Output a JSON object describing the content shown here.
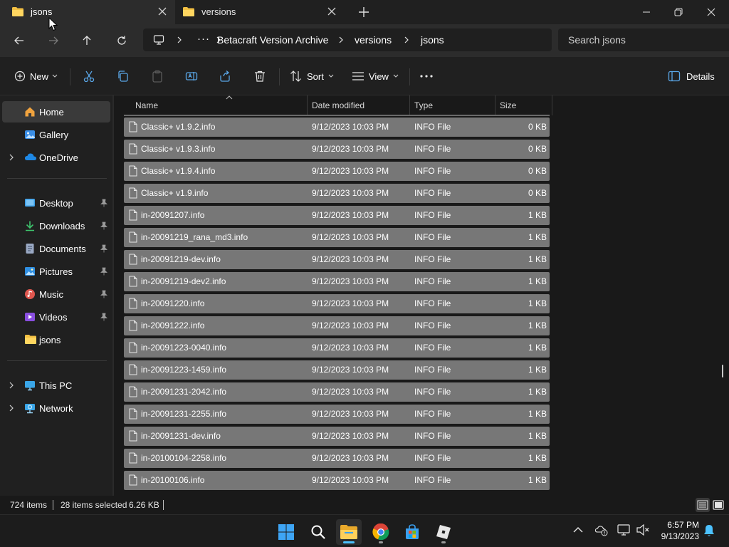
{
  "tabs": [
    {
      "title": "jsons",
      "active": true
    },
    {
      "title": "versions",
      "active": false
    }
  ],
  "address": {
    "segments": [
      "Betacraft Version Archive",
      "versions",
      "jsons"
    ]
  },
  "search": {
    "placeholder": "Search jsons"
  },
  "commands": {
    "new_label": "New",
    "sort_label": "Sort",
    "view_label": "View",
    "details_label": "Details"
  },
  "sidebar": {
    "items": [
      {
        "label": "Home",
        "icon": "home-icon"
      },
      {
        "label": "Gallery",
        "icon": "gallery-icon"
      },
      {
        "label": "OneDrive",
        "icon": "onedrive-icon"
      },
      {
        "label": "Desktop",
        "icon": "desktop-icon"
      },
      {
        "label": "Downloads",
        "icon": "downloads-icon"
      },
      {
        "label": "Documents",
        "icon": "documents-icon"
      },
      {
        "label": "Pictures",
        "icon": "pictures-icon"
      },
      {
        "label": "Music",
        "icon": "music-icon"
      },
      {
        "label": "Videos",
        "icon": "videos-icon"
      },
      {
        "label": "jsons",
        "icon": "folder-icon"
      },
      {
        "label": "This PC",
        "icon": "this-pc-icon"
      },
      {
        "label": "Network",
        "icon": "network-icon"
      }
    ]
  },
  "columns": {
    "name": "Name",
    "date": "Date modified",
    "type": "Type",
    "size": "Size"
  },
  "files": [
    {
      "name": "Classic+ v1.9.2.info",
      "date": "9/12/2023 10:03 PM",
      "type": "INFO File",
      "size": "0 KB"
    },
    {
      "name": "Classic+ v1.9.3.info",
      "date": "9/12/2023 10:03 PM",
      "type": "INFO File",
      "size": "0 KB"
    },
    {
      "name": "Classic+ v1.9.4.info",
      "date": "9/12/2023 10:03 PM",
      "type": "INFO File",
      "size": "0 KB"
    },
    {
      "name": "Classic+ v1.9.info",
      "date": "9/12/2023 10:03 PM",
      "type": "INFO File",
      "size": "0 KB"
    },
    {
      "name": "in-20091207.info",
      "date": "9/12/2023 10:03 PM",
      "type": "INFO File",
      "size": "1 KB"
    },
    {
      "name": "in-20091219_rana_md3.info",
      "date": "9/12/2023 10:03 PM",
      "type": "INFO File",
      "size": "1 KB"
    },
    {
      "name": "in-20091219-dev.info",
      "date": "9/12/2023 10:03 PM",
      "type": "INFO File",
      "size": "1 KB"
    },
    {
      "name": "in-20091219-dev2.info",
      "date": "9/12/2023 10:03 PM",
      "type": "INFO File",
      "size": "1 KB"
    },
    {
      "name": "in-20091220.info",
      "date": "9/12/2023 10:03 PM",
      "type": "INFO File",
      "size": "1 KB"
    },
    {
      "name": "in-20091222.info",
      "date": "9/12/2023 10:03 PM",
      "type": "INFO File",
      "size": "1 KB"
    },
    {
      "name": "in-20091223-0040.info",
      "date": "9/12/2023 10:03 PM",
      "type": "INFO File",
      "size": "1 KB"
    },
    {
      "name": "in-20091223-1459.info",
      "date": "9/12/2023 10:03 PM",
      "type": "INFO File",
      "size": "1 KB"
    },
    {
      "name": "in-20091231-2042.info",
      "date": "9/12/2023 10:03 PM",
      "type": "INFO File",
      "size": "1 KB"
    },
    {
      "name": "in-20091231-2255.info",
      "date": "9/12/2023 10:03 PM",
      "type": "INFO File",
      "size": "1 KB"
    },
    {
      "name": "in-20091231-dev.info",
      "date": "9/12/2023 10:03 PM",
      "type": "INFO File",
      "size": "1 KB"
    },
    {
      "name": "in-20100104-2258.info",
      "date": "9/12/2023 10:03 PM",
      "type": "INFO File",
      "size": "1 KB"
    },
    {
      "name": "in-20100106.info",
      "date": "9/12/2023 10:03 PM",
      "type": "INFO File",
      "size": "1 KB"
    }
  ],
  "status": {
    "item_count": "724 items",
    "selected": "28 items selected",
    "selected_size": "6.26 KB"
  },
  "clock": {
    "time": "6:57 PM",
    "date": "9/13/2023"
  },
  "colors": {
    "accent": "#4cc2ff",
    "selection": "#777777",
    "folder": "#f3c043"
  }
}
